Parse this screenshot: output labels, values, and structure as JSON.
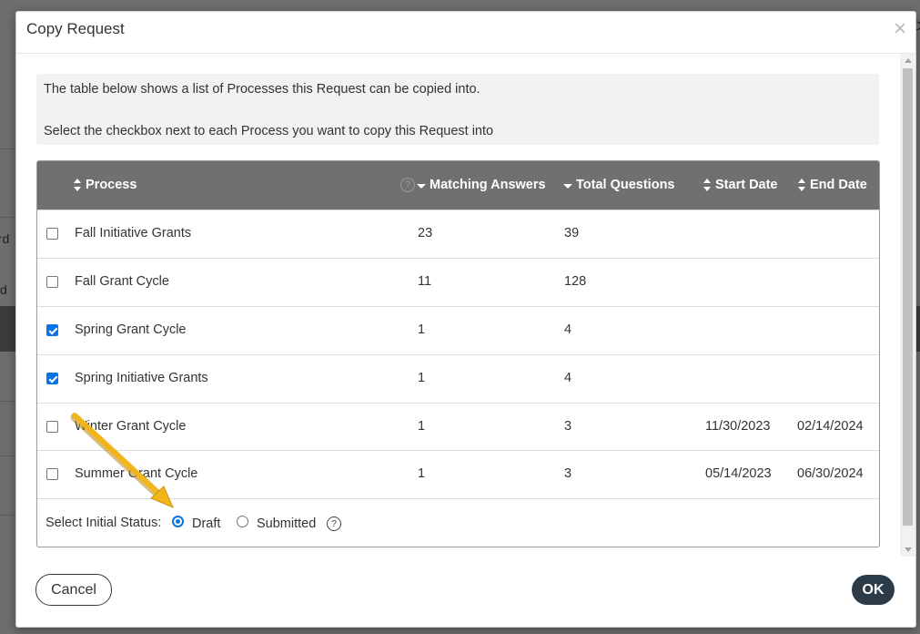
{
  "background": {
    "fragments": [
      "ard",
      "d",
      "De"
    ]
  },
  "dialog": {
    "title": "Copy Request",
    "close_glyph": "×",
    "info": {
      "line1": "The table below shows a list of Processes this Request can be copied into.",
      "line2": "Select the checkbox next to each Process you want to copy this Request into"
    },
    "table": {
      "headers": {
        "process": "Process",
        "matching_help": "?",
        "matching": "Matching Answers",
        "total": "Total Questions",
        "start": "Start Date",
        "end": "End Date"
      },
      "rows": [
        {
          "checked": false,
          "process": "Fall Initiative Grants",
          "matching": "23",
          "total": "39",
          "start": "",
          "end": ""
        },
        {
          "checked": false,
          "process": "Fall Grant Cycle",
          "matching": "11",
          "total": "128",
          "start": "",
          "end": ""
        },
        {
          "checked": true,
          "process": "Spring Grant Cycle",
          "matching": "1",
          "total": "4",
          "start": "",
          "end": ""
        },
        {
          "checked": true,
          "process": "Spring Initiative Grants",
          "matching": "1",
          "total": "4",
          "start": "",
          "end": ""
        },
        {
          "checked": false,
          "process": "Winter Grant Cycle",
          "matching": "1",
          "total": "3",
          "start": "11/30/2023",
          "end": "02/14/2024"
        },
        {
          "checked": false,
          "process": "Summer Grant Cycle",
          "matching": "1",
          "total": "3",
          "start": "05/14/2023",
          "end": "06/30/2024"
        }
      ]
    },
    "status": {
      "label": "Select Initial Status:",
      "options": [
        {
          "label": "Draft",
          "selected": true
        },
        {
          "label": "Submitted",
          "selected": false
        }
      ],
      "help": "?"
    },
    "buttons": {
      "cancel": "Cancel",
      "ok": "OK"
    }
  },
  "annotation": {
    "arrow_color": "#f2b51c"
  }
}
